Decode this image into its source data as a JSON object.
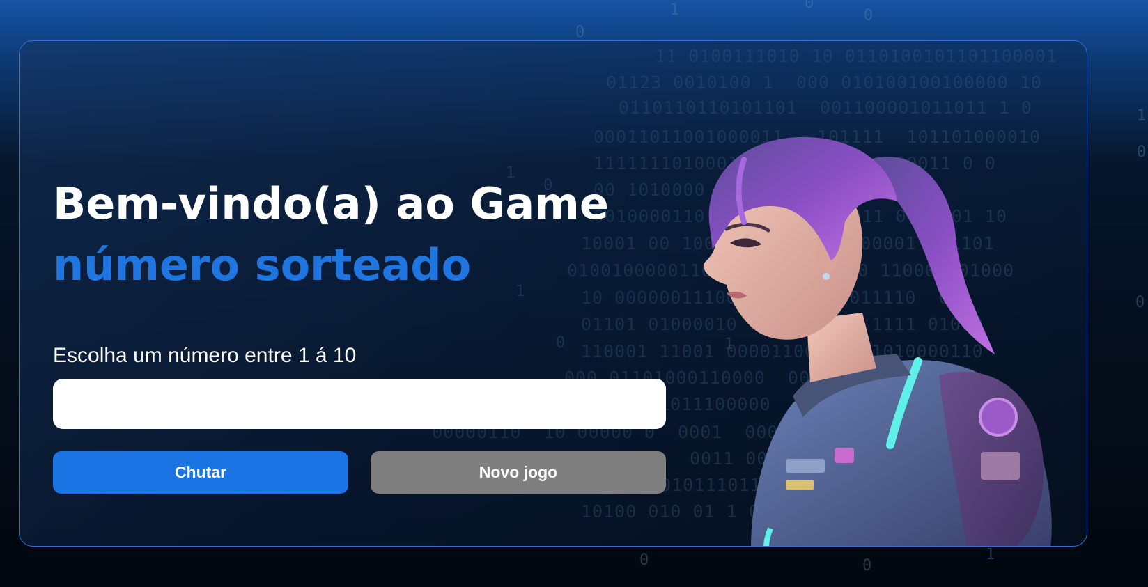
{
  "header": {
    "title": "Bem-vindo(a) ao Game",
    "subtitle": "número sorteado"
  },
  "form": {
    "prompt": "Escolha um número entre 1 á 10",
    "input_value": "",
    "input_placeholder": ""
  },
  "buttons": {
    "guess_label": "Chutar",
    "new_game_label": "Novo jogo"
  },
  "decoration": {
    "binary_lines": [
      "11 0100111010 10 0110100101101100001",
      "01123 0010100 1  000 010100100100000 10",
      "0110110110101101  001100001011011 1 0",
      "00011011001000011   101111  101101000010",
      "111111101000100  10  10100000011 0 0",
      "00 1010000  010  1  01 001011",
      "0010000110  0101001   1011 0   001 10",
      "10001 00 1000  010  00 1100001  01101",
      "01001000001101  10100  1000 11000 001000",
      "10 00000011100  00011   011110  0",
      "01101 01000010  1101011   1111 01000",
      "110001 11001 00001100    01010000110",
      "000 01101000110000  000 1000  00 1010",
      "01011100000   001  11  0011   0",
      "00000110  10 00000 0  0001  00011 0",
      "0011 00  01  001001  001    0",
      "01101011101101 011 00  01  01011",
      "10100 010 01 1 0111 0 00000 01 000"
    ],
    "scattered_digits": [
      "1",
      "0",
      "0",
      "0",
      "1",
      "0",
      "1",
      "1",
      "0",
      "0",
      "1",
      "0",
      "0",
      "1",
      "0"
    ],
    "colors": {
      "accent": "#1f76e0",
      "guess_button": "#1b74e4",
      "new_game_button": "#7f7f7f",
      "card_border": "#2f6fd6",
      "hair": "#8a4fc4",
      "suit": "#5a6f9e",
      "neon": "#5ff0e8"
    },
    "illustration": "character-portrait"
  }
}
